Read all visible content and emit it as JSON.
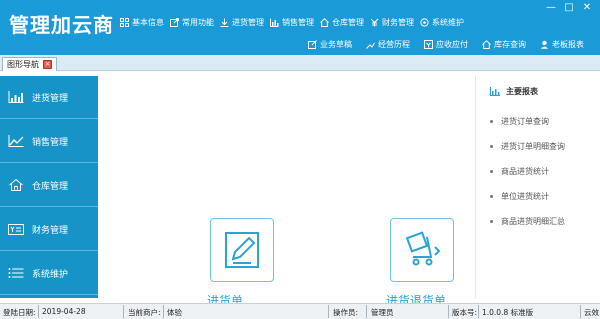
{
  "header": {
    "title": "管理加云商",
    "top_nav": [
      {
        "label": "基本信息",
        "icon": "grid-icon"
      },
      {
        "label": "常用功能",
        "icon": "external-link-icon"
      },
      {
        "label": "进货管理",
        "icon": "import-icon"
      },
      {
        "label": "销售管理",
        "icon": "bar-chart-icon"
      },
      {
        "label": "仓库管理",
        "icon": "home-icon"
      },
      {
        "label": "财务管理",
        "icon": "finance-icon"
      },
      {
        "label": "系统维护",
        "icon": "settings-icon"
      }
    ],
    "sub_nav": [
      {
        "label": "业务草稿",
        "icon": "draft-icon"
      },
      {
        "label": "经营历程",
        "icon": "history-icon"
      },
      {
        "label": "应收应付",
        "icon": "receivable-icon"
      },
      {
        "label": "库存查询",
        "icon": "stock-icon"
      },
      {
        "label": "老板报表",
        "icon": "user-report-icon"
      }
    ],
    "window_controls": {
      "minimize": "—",
      "maximize": "□",
      "close": "✕"
    }
  },
  "tabs": [
    {
      "label": "图形导航"
    }
  ],
  "sidebar": {
    "items": [
      {
        "label": "进货管理",
        "icon": "bar-chart-icon"
      },
      {
        "label": "销售管理",
        "icon": "line-chart-icon"
      },
      {
        "label": "仓库管理",
        "icon": "home-icon"
      },
      {
        "label": "财务管理",
        "icon": "card-icon"
      },
      {
        "label": "系统维护",
        "icon": "list-icon"
      }
    ]
  },
  "main": {
    "cards": [
      {
        "label": "进货单",
        "icon": "edit-icon"
      },
      {
        "label": "进货退货单",
        "icon": "cart-return-icon"
      }
    ]
  },
  "right_panel": {
    "title": "主要报表",
    "items": [
      {
        "label": "进货订单查询"
      },
      {
        "label": "进货订单明细查询"
      },
      {
        "label": "商品进货统计"
      },
      {
        "label": "单位进货统计"
      },
      {
        "label": "商品进货明细汇总"
      }
    ]
  },
  "status_bar": {
    "login_date_label": "登陆日期:",
    "login_date": "2019-04-28",
    "merchant_label": "当前商户:",
    "merchant": "体验",
    "operator_label": "操作员:",
    "operator": "管理员",
    "version_label": "版本号:",
    "version": "1.0.0.8 标准版",
    "extra": "云效"
  },
  "colors": {
    "primary": "#1a9ad6",
    "sidebar": "#1794c7",
    "accent": "#2aa3d8"
  }
}
